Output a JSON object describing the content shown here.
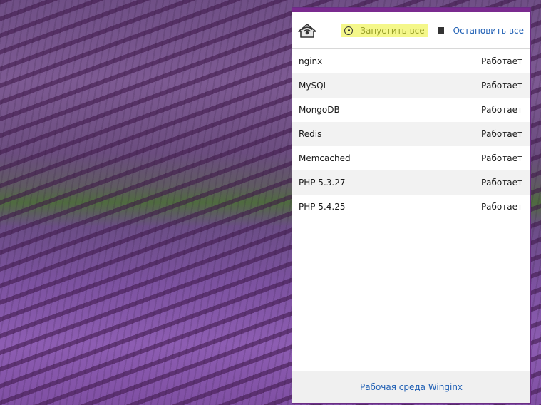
{
  "toolbar": {
    "logo_icon": "winginx-home-icon",
    "start_all_label": "Запустить все",
    "start_all_icon": "play-circle-icon",
    "stop_all_label": "Остановить все",
    "stop_all_icon": "stop-square-icon",
    "highlight_color": "#f4f78a"
  },
  "services": [
    {
      "name": "nginx",
      "status": "Работает"
    },
    {
      "name": "MySQL",
      "status": "Работает"
    },
    {
      "name": "MongoDB",
      "status": "Работает"
    },
    {
      "name": "Redis",
      "status": "Работает"
    },
    {
      "name": "Memcached",
      "status": "Работает"
    },
    {
      "name": "PHP 5.3.27",
      "status": "Работает"
    },
    {
      "name": "PHP 5.4.25",
      "status": "Работает"
    }
  ],
  "footer": {
    "link_label": "Рабочая среда Winginx"
  },
  "colors": {
    "accent": "#7a2a8f",
    "link": "#1f5fb4"
  }
}
